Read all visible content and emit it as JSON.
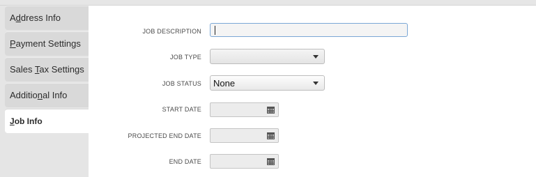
{
  "sidebar": {
    "tabs": [
      {
        "pre": "A",
        "key": "d",
        "post": "dress Info"
      },
      {
        "pre": "",
        "key": "P",
        "post": "ayment Settings"
      },
      {
        "pre": "Sales ",
        "key": "T",
        "post": "ax Settings"
      },
      {
        "pre": "Additio",
        "key": "n",
        "post": "al Info"
      },
      {
        "pre": "",
        "key": "J",
        "post": "ob Info"
      }
    ],
    "active_index": 4
  },
  "form": {
    "job_description_label": "JOB DESCRIPTION",
    "job_description_value": "",
    "job_type_label": "JOB TYPE",
    "job_type_value": "",
    "job_status_label": "JOB STATUS",
    "job_status_value": "None",
    "start_date_label": "START DATE",
    "start_date_value": "",
    "projected_end_date_label": "PROJECTED END DATE",
    "projected_end_date_value": "",
    "end_date_label": "END DATE",
    "end_date_value": ""
  },
  "icons": {
    "dropdown": "chevron-down-icon",
    "calendar": "calendar-icon"
  }
}
